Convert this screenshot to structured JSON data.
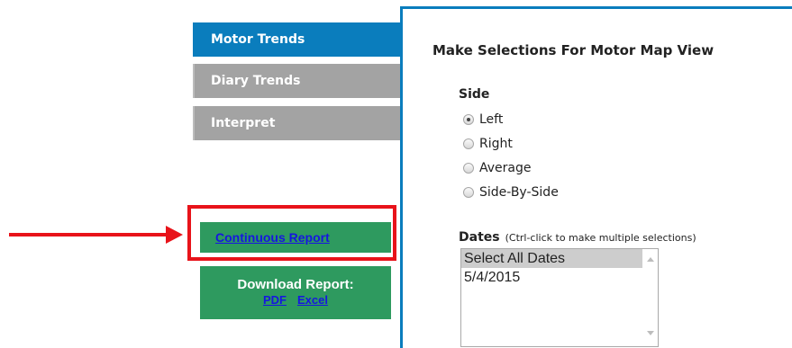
{
  "nav": {
    "tabs": [
      {
        "label": "Motor Trends",
        "active": true
      },
      {
        "label": "Diary Trends",
        "active": false
      },
      {
        "label": "Interpret",
        "active": false
      }
    ]
  },
  "reports": {
    "continuous_label": "Continuous Report",
    "download_title": "Download Report:",
    "pdf_label": "PDF",
    "excel_label": "Excel"
  },
  "panel": {
    "title": "Make Selections For Motor Map View",
    "side_label": "Side",
    "side_options": [
      {
        "label": "Left",
        "checked": true
      },
      {
        "label": "Right",
        "checked": false
      },
      {
        "label": "Average",
        "checked": false
      },
      {
        "label": "Side-By-Side",
        "checked": false
      }
    ],
    "dates_label": "Dates",
    "dates_hint": "(Ctrl-click to make multiple selections)",
    "dates_options": [
      {
        "label": "Select All Dates",
        "selected": true
      },
      {
        "label": "5/4/2015",
        "selected": false
      }
    ]
  },
  "colors": {
    "tab_active": "#0a7dbd",
    "tab_inactive": "#a3a3a3",
    "report_green": "#2e9a5f",
    "annotation_red": "#e8131a",
    "link_blue": "#1616e0"
  }
}
